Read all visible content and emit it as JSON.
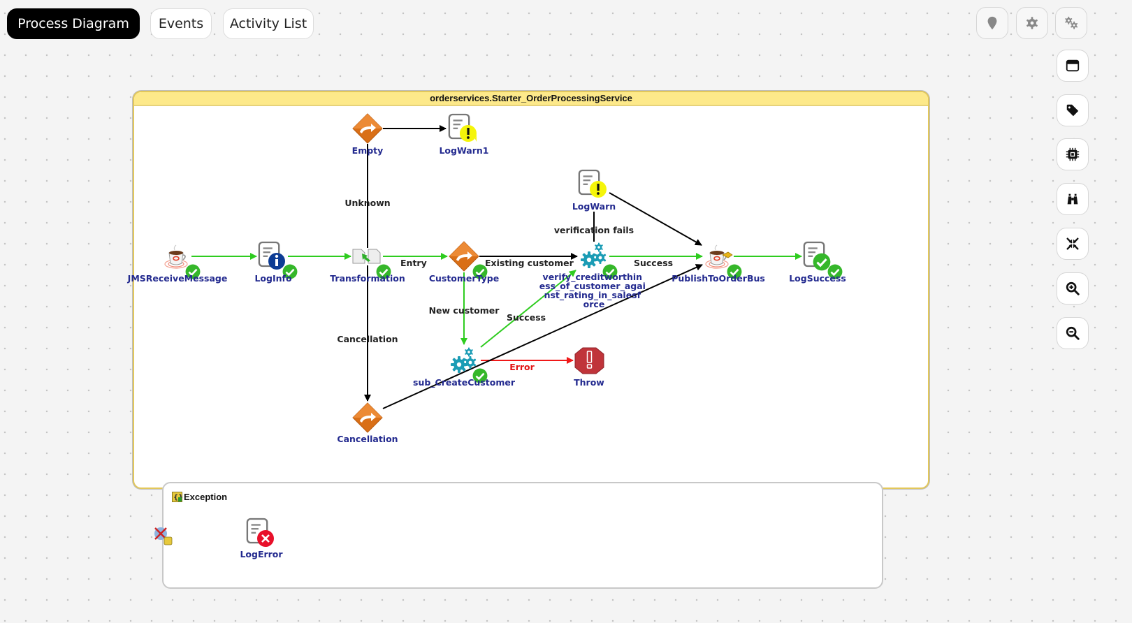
{
  "tabs": [
    {
      "label": "Process Diagram",
      "active": true
    },
    {
      "label": "Events",
      "active": false
    },
    {
      "label": "Activity List",
      "active": false
    }
  ],
  "top_tools": [
    {
      "icon": "map-pin-icon"
    },
    {
      "icon": "gear-icon"
    },
    {
      "icon": "gears-icon"
    }
  ],
  "side_tools": [
    {
      "icon": "window-icon"
    },
    {
      "icon": "tag-icon"
    },
    {
      "icon": "chip-icon"
    },
    {
      "icon": "binoculars-icon"
    },
    {
      "icon": "compress-icon"
    },
    {
      "icon": "zoom-in-icon"
    },
    {
      "icon": "zoom-out-icon"
    }
  ],
  "process": {
    "title": "orderservices.Starter_OrderProcessingService",
    "nodes": {
      "jms_receive": {
        "label": "JMSReceiveMessage",
        "type": "jms",
        "status": "success"
      },
      "log_info": {
        "label": "LogInfo",
        "type": "log-info",
        "status": "success"
      },
      "transformation": {
        "label": "Transformation",
        "type": "mapper",
        "status": "success"
      },
      "empty": {
        "label": "Empty",
        "type": "router"
      },
      "log_warn1": {
        "label": "LogWarn1",
        "type": "log-warn"
      },
      "customer_type": {
        "label": "CustomerType",
        "type": "router",
        "status": "success"
      },
      "log_warn": {
        "label": "LogWarn",
        "type": "log-warn"
      },
      "verify_credit": {
        "label_lines": [
          "verify_creditworthin",
          "ess_of_customer_agai",
          "nst_rating_in_salesf",
          "orce"
        ],
        "type": "subprocess",
        "status": "success"
      },
      "publish": {
        "label": "PublishToOrderBus",
        "type": "jms-send",
        "status": "success"
      },
      "log_success": {
        "label": "LogSuccess",
        "type": "log-success",
        "status": "success"
      },
      "sub_create": {
        "label": "sub_CreateCustomer",
        "type": "subprocess",
        "status": "success"
      },
      "throw": {
        "label": "Throw",
        "type": "throw"
      },
      "cancellation": {
        "label": "Cancellation",
        "type": "router"
      }
    },
    "edge_labels": {
      "unknown": "Unknown",
      "entry": "Entry",
      "cancellation": "Cancellation",
      "existing_customer": "Existing customer",
      "verification_fails": "verification fails",
      "success_verify": "Success",
      "new_customer": "New customer",
      "success_sub": "Success",
      "error": "Error"
    }
  },
  "exception": {
    "title": "Exception",
    "nodes": {
      "log_error": {
        "label": "LogError",
        "type": "log-error"
      }
    }
  },
  "colors": {
    "success_edge": "#2ecc1f",
    "normal_edge": "#000000",
    "error_edge": "#f01818",
    "router_orange": "#e07a20",
    "node_label_blue": "#232a8f",
    "frame_header": "#fde98a",
    "subprocess_teal": "#1b9cb5"
  }
}
